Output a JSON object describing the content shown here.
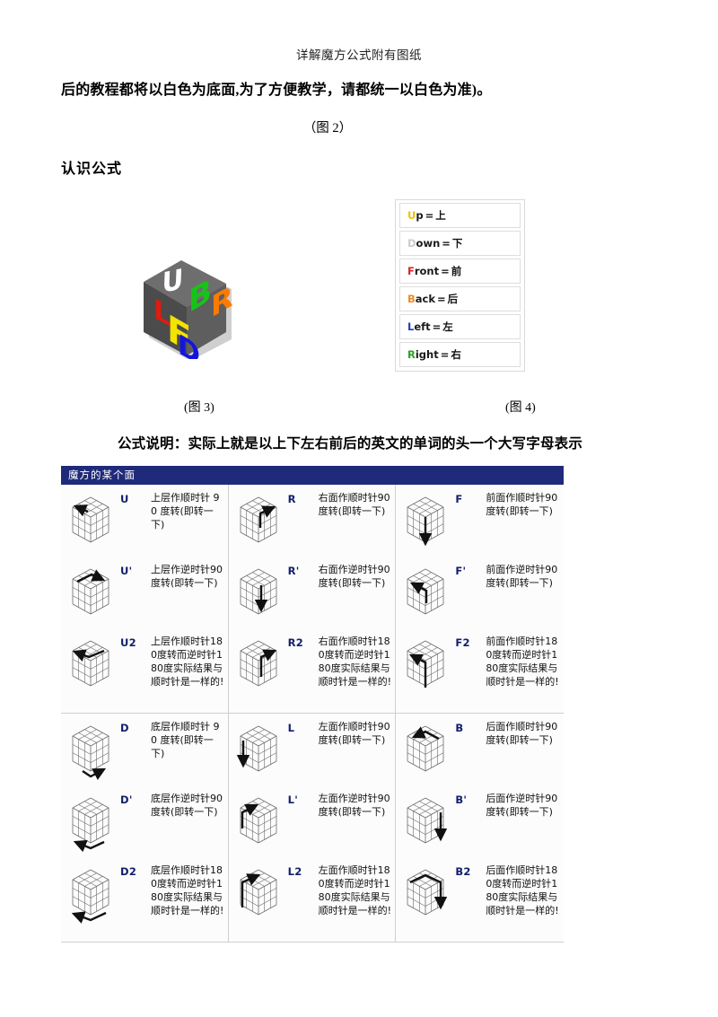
{
  "page": {
    "running_head": "详解魔方公式附有图纸",
    "paragraph": "后的教程都将以白色为底面,为了方便教学，请都统一以白色为准)。",
    "fig2_caption": "（图 2）",
    "section_heading": "认识公式",
    "fig3_caption": "(图 3)",
    "fig4_caption": "(图 4)",
    "formula_note": "公式说明：实际上就是以上下左右前后的英文的单词的头一个大写字母表示"
  },
  "cube_illustration": {
    "face_labels": [
      {
        "letter": "U",
        "color": "#ffffff"
      },
      {
        "letter": "L",
        "color": "#e01b10"
      },
      {
        "letter": "F",
        "color": "#f2e300"
      },
      {
        "letter": "B",
        "color": "#19c219"
      },
      {
        "letter": "R",
        "color": "#ff7a00"
      },
      {
        "letter": "D",
        "color": "#1414e0"
      }
    ],
    "body_color": "#5a5a5a"
  },
  "legend": {
    "rows": [
      {
        "initial": "U",
        "rest": "p",
        "eq": "=",
        "cn": "上",
        "color": "#f0c000"
      },
      {
        "initial": "D",
        "rest": "own",
        "eq": "=",
        "cn": "下",
        "color": "#cccccc"
      },
      {
        "initial": "F",
        "rest": "ront",
        "eq": "=",
        "cn": "前",
        "color": "#d8232a"
      },
      {
        "initial": "B",
        "rest": "ack",
        "eq": "=",
        "cn": "后",
        "color": "#f08a24"
      },
      {
        "initial": "L",
        "rest": "eft",
        "eq": "=",
        "cn": "左",
        "color": "#1f3fbf"
      },
      {
        "initial": "R",
        "rest": "ight",
        "eq": "=",
        "cn": "右",
        "color": "#2aa02a"
      }
    ]
  },
  "notation_table": {
    "title": "魔方的某个面",
    "title_bg": "#1f2a7a",
    "half_one": [
      [
        {
          "code": "U",
          "desc": "上层作顺时针 90 度转(即转一下)",
          "cube": "U"
        },
        {
          "code": "R",
          "desc": "右面作顺时针90度转(即转一下)",
          "cube": "R"
        },
        {
          "code": "F",
          "desc": "前面作顺时针90度转(即转一下)",
          "cube": "F"
        }
      ],
      [
        {
          "code": "U'",
          "desc": "上层作逆时针90度转(即转一下)",
          "cube": "Up"
        },
        {
          "code": "R'",
          "desc": "右面作逆时针90度转(即转一下)",
          "cube": "Rp"
        },
        {
          "code": "F'",
          "desc": "前面作逆时针90度转(即转一下)",
          "cube": "Fp"
        }
      ],
      [
        {
          "code": "U2",
          "desc": "上层作顺时针180度转而逆时针180度实际结果与顺时针是一样的!",
          "cube": "U2"
        },
        {
          "code": "R2",
          "desc": "右面作顺时针180度转而逆时针180度实际结果与顺时针是一样的!",
          "cube": "R2"
        },
        {
          "code": "F2",
          "desc": "前面作顺时针180度转而逆时针180度实际结果与顺时针是一样的!",
          "cube": "F2"
        }
      ]
    ],
    "half_two": [
      [
        {
          "code": "D",
          "desc": "底层作顺时针 90 度转(即转一下)",
          "cube": "D"
        },
        {
          "code": "L",
          "desc": "左面作顺时针90度转(即转一下)",
          "cube": "L"
        },
        {
          "code": "B",
          "desc": "后面作顺时针90度转(即转一下)",
          "cube": "B"
        }
      ],
      [
        {
          "code": "D'",
          "desc": "底层作逆时针90度转(即转一下)",
          "cube": "Dp"
        },
        {
          "code": "L'",
          "desc": "左面作逆时针90度转(即转一下)",
          "cube": "Lp"
        },
        {
          "code": "B'",
          "desc": "后面作逆时针90度转(即转一下)",
          "cube": "Bp"
        }
      ],
      [
        {
          "code": "D2",
          "desc": "底层作顺时针180度转而逆时针180度实际结果与顺时针是一样的!",
          "cube": "D2"
        },
        {
          "code": "L2",
          "desc": "左面作顺时针180度转而逆时针180度实际结果与顺时针是一样的!",
          "cube": "L2"
        },
        {
          "code": "B2",
          "desc": "后面作顺时针180度转而逆时针180度实际结果与顺时针是一样的!",
          "cube": "B2"
        }
      ]
    ]
  }
}
